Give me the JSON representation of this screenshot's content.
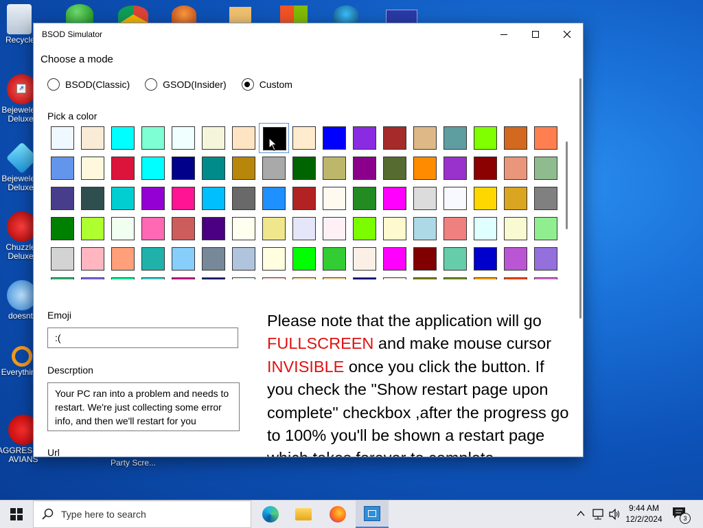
{
  "desktop": {
    "icons": [
      {
        "label": "Recycle Bin"
      },
      {
        "label": "Bejeweled Deluxe"
      },
      {
        "label": "Bejeweled Deluxe"
      },
      {
        "label": "Chuzzle Deluxe"
      },
      {
        "label": "doesnt"
      },
      {
        "label": "Everything"
      },
      {
        "label": "AGGRESSIVE AVIANS"
      },
      {
        "label": "Party Scre..."
      }
    ]
  },
  "window": {
    "title": "BSOD Simulator",
    "controls": {
      "minimize": "—",
      "maximize": "☐",
      "close": "✕"
    },
    "mode_label": "Choose a mode",
    "modes": [
      {
        "label": "BSOD(Classic)",
        "selected": false
      },
      {
        "label": "GSOD(Insider)",
        "selected": false
      },
      {
        "label": "Custom",
        "selected": true
      }
    ],
    "pick_color_label": "Pick a color",
    "selected_color": "#000000",
    "palette": [
      "#F0F8FF",
      "#FAEBD7",
      "#00FFFF",
      "#7FFFD4",
      "#F0FFFF",
      "#F5F5DC",
      "#FFE4C4",
      "#000000",
      "#FFEBCD",
      "#0000FF",
      "#8A2BE2",
      "#A52A2A",
      "#DEB887",
      "#5F9EA0",
      "#7FFF00",
      "#D2691E",
      "#FF7F50",
      "#6495ED",
      "#FFF8DC",
      "#DC143C",
      "#00FFFF",
      "#00008B",
      "#008B8B",
      "#B8860B",
      "#A9A9A9",
      "#006400",
      "#BDB76B",
      "#8B008B",
      "#556B2F",
      "#FF8C00",
      "#9932CC",
      "#8B0000",
      "#E9967A",
      "#8FBC8F",
      "#483D8B",
      "#2F4F4F",
      "#00CED1",
      "#9400D3",
      "#FF1493",
      "#00BFFF",
      "#696969",
      "#1E90FF",
      "#B22222",
      "#FFFAF0",
      "#228B22",
      "#FF00FF",
      "#DCDCDC",
      "#F8F8FF",
      "#FFD700",
      "#DAA520",
      "#808080",
      "#008000",
      "#ADFF2F",
      "#F0FFF0",
      "#FF69B4",
      "#CD5C5C",
      "#4B0082",
      "#FFFFF0",
      "#F0E68C",
      "#E6E6FA",
      "#FFF0F5",
      "#7CFC00",
      "#FFFACD",
      "#ADD8E6",
      "#F08080",
      "#E0FFFF",
      "#FAFAD2",
      "#90EE90",
      "#D3D3D3",
      "#FFB6C1",
      "#FFA07A",
      "#20B2AA",
      "#87CEFA",
      "#778899",
      "#B0C4DE",
      "#FFFFE0",
      "#00FF00",
      "#32CD32",
      "#FAF0E6",
      "#FF00FF",
      "#800000",
      "#66CDAA",
      "#0000CD",
      "#BA55D3",
      "#9370DB",
      "#3CB371",
      "#7B68EE",
      "#00FA9A",
      "#48D1CC",
      "#C71585",
      "#191970",
      "#F5FFFA",
      "#FFE4E1",
      "#FFE4B5",
      "#FFDEAD",
      "#000080",
      "#FDF5E6",
      "#808000",
      "#6B8E23",
      "#FFA500",
      "#FF4500",
      "#DA70D6"
    ],
    "emoji_label": "Emoji",
    "emoji_value": ":(",
    "description_label": "Descrption",
    "description_value": "Your PC ran into a problem and needs to restart. We're just collecting some error info, and then we'll restart for you",
    "url_label": "Url",
    "note": {
      "part1": "Please note that the application will go ",
      "red1": "FULLSCREEN",
      "part2": " and make mouse cursor ",
      "red2": "INVISIBLE",
      "part3": " once you click the button. If you check the \"Show restart page upon complete\" checkbox ,after the progress go to 100% you'll be shown a restart page which takes forever to complete"
    }
  },
  "taskbar": {
    "search_placeholder": "Type here to search",
    "clock_time": "9:44 AM",
    "clock_date": "12/2/2024",
    "notification_count": "3"
  }
}
